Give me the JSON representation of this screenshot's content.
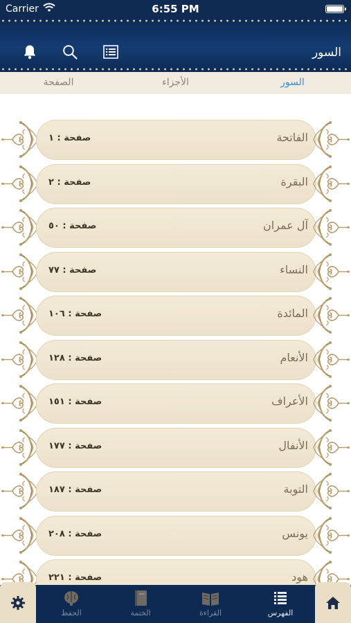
{
  "status_bar": {
    "carrier": "Carrier",
    "time": "6:55 PM"
  },
  "header": {
    "title": "السور"
  },
  "tabs": [
    {
      "label": "السور",
      "active": true
    },
    {
      "label": "الأجزاء",
      "active": false
    },
    {
      "label": "الصفحة",
      "active": false
    }
  ],
  "surahs": [
    {
      "name": "الفاتحة",
      "page": "صفحة : ١"
    },
    {
      "name": "البقرة",
      "page": "صفحة : ٢"
    },
    {
      "name": "آل عمران",
      "page": "صفحة : ٥٠"
    },
    {
      "name": "النساء",
      "page": "صفحة : ٧٧"
    },
    {
      "name": "المائدة",
      "page": "صفحة : ١٠٦"
    },
    {
      "name": "الأنعام",
      "page": "صفحة : ١٢٨"
    },
    {
      "name": "الأعراف",
      "page": "صفحة : ١٥١"
    },
    {
      "name": "الأنفال",
      "page": "صفحة : ١٧٧"
    },
    {
      "name": "التوبة",
      "page": "صفحة : ١٨٧"
    },
    {
      "name": "يونس",
      "page": "صفحة : ٢٠٨"
    },
    {
      "name": "هود",
      "page": "صفحة : ٢٢١"
    }
  ],
  "bottom_nav": {
    "items": [
      {
        "label": "الفهرس",
        "icon": "list-icon",
        "active": true
      },
      {
        "label": "القراءة",
        "icon": "open-book-icon",
        "active": false
      },
      {
        "label": "الختمة",
        "icon": "closed-book-icon",
        "active": false
      },
      {
        "label": "الحفظ",
        "icon": "brain-icon",
        "active": false
      }
    ]
  },
  "colors": {
    "header": "#0d2a55",
    "accent": "#3d8ae0",
    "pill": "#f0e6d1",
    "ornament": "#b59a6a"
  }
}
